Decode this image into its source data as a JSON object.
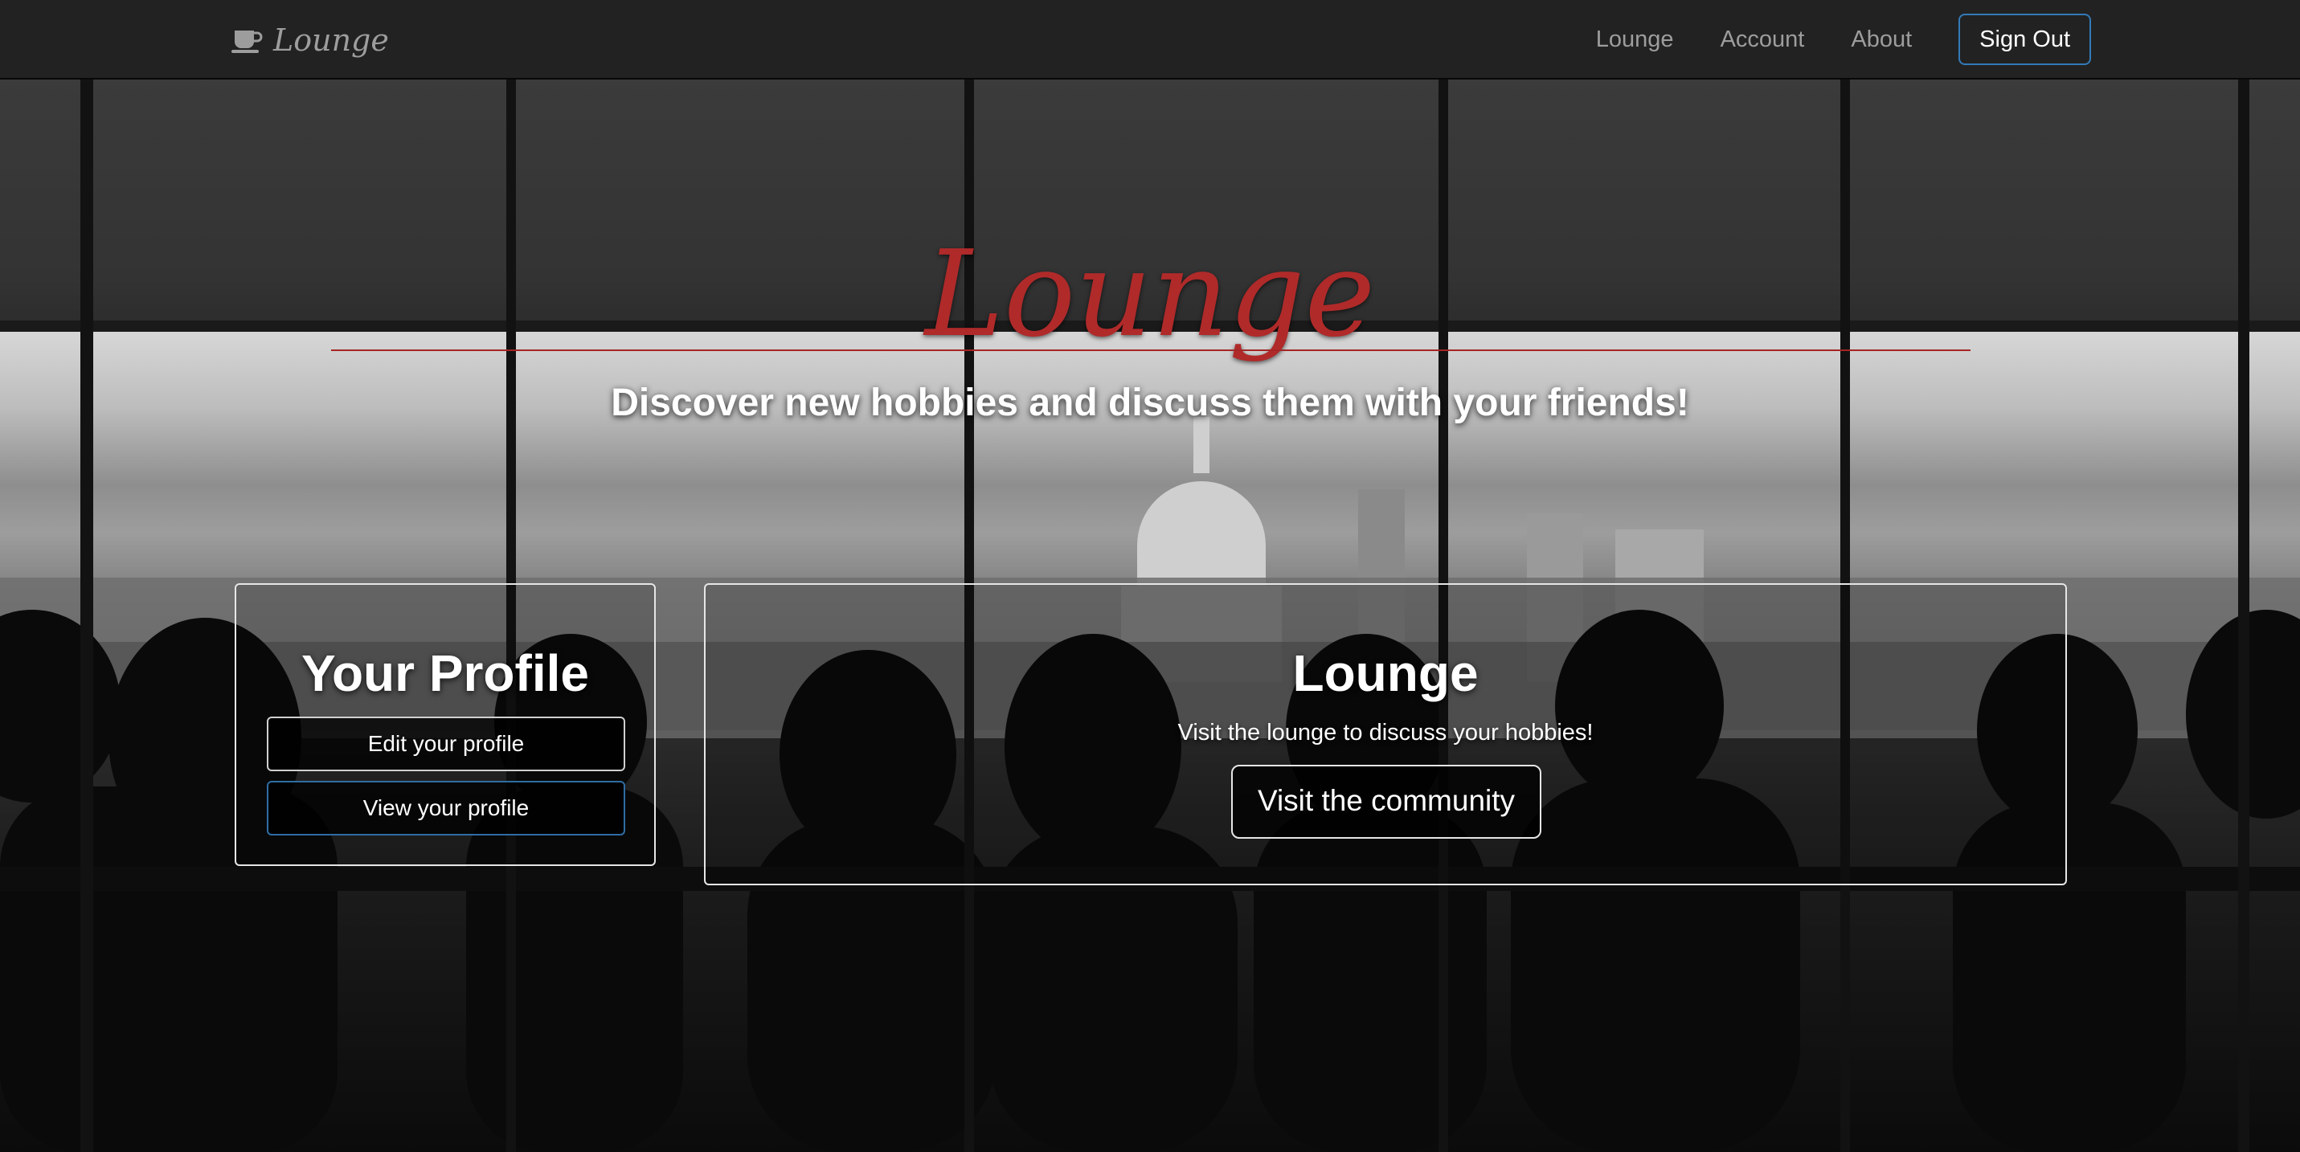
{
  "navbar": {
    "brand_icon": "coffee-cup-icon",
    "brand": "Lounge",
    "links": [
      "Lounge",
      "Account",
      "About"
    ],
    "sign_out": "Sign Out"
  },
  "hero": {
    "title": "Lounge",
    "tagline": "Discover new hobbies and discuss them with your friends!"
  },
  "profile_card": {
    "title": "Your Profile",
    "edit_button": "Edit your profile",
    "view_button": "View your profile"
  },
  "lounge_card": {
    "title": "Lounge",
    "description": "Visit the lounge to discuss your hobbies!",
    "visit_button": "Visit the community"
  },
  "colors": {
    "navbar_bg": "#222222",
    "nav_text": "#9d9d9d",
    "accent_red": "#b02a2a",
    "button_border_blue": "#337ab7"
  }
}
